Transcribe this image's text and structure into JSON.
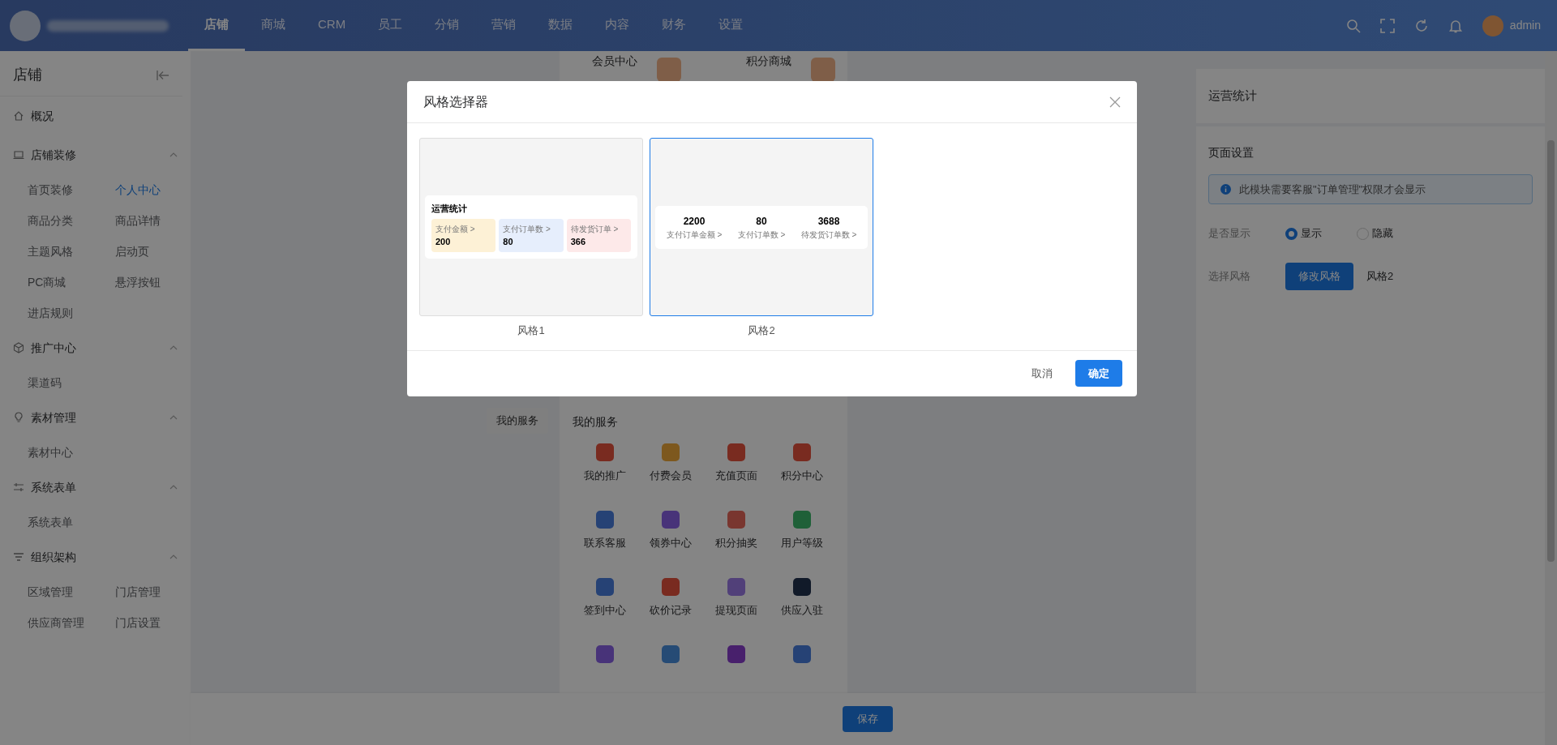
{
  "top_nav": {
    "tabs": [
      {
        "label": "店铺",
        "selected": true
      },
      {
        "label": "商城",
        "selected": false
      },
      {
        "label": "CRM",
        "selected": false
      },
      {
        "label": "员工",
        "selected": false
      },
      {
        "label": "分销",
        "selected": false
      },
      {
        "label": "营销",
        "selected": false
      },
      {
        "label": "数据",
        "selected": false
      },
      {
        "label": "内容",
        "selected": false
      },
      {
        "label": "财务",
        "selected": false
      },
      {
        "label": "设置",
        "selected": false
      }
    ],
    "user": "admin"
  },
  "sidebar": {
    "title": "店铺",
    "groups": [
      {
        "kind": "link",
        "label": "概况"
      },
      {
        "kind": "group",
        "label": "店铺装修",
        "expanded": true,
        "items": [
          {
            "label": "首页装修",
            "selected": false
          },
          {
            "label": "个人中心",
            "selected": true
          },
          {
            "label": "商品分类",
            "selected": false
          },
          {
            "label": "商品详情",
            "selected": false
          },
          {
            "label": "主题风格",
            "selected": false
          },
          {
            "label": "启动页",
            "selected": false
          },
          {
            "label": "PC商城",
            "selected": false
          },
          {
            "label": "悬浮按钮",
            "selected": false
          },
          {
            "label": "进店规则",
            "selected": false
          }
        ]
      },
      {
        "kind": "group",
        "label": "推广中心",
        "expanded": true,
        "items": [
          {
            "label": "渠道码",
            "selected": false
          }
        ]
      },
      {
        "kind": "group",
        "label": "素材管理",
        "expanded": true,
        "items": [
          {
            "label": "素材中心",
            "selected": false
          }
        ]
      },
      {
        "kind": "group",
        "label": "系统表单",
        "expanded": true,
        "items": [
          {
            "label": "系统表单",
            "selected": false
          }
        ]
      },
      {
        "kind": "group",
        "label": "组织架构",
        "expanded": true,
        "items": [
          {
            "label": "区域管理",
            "selected": false
          },
          {
            "label": "门店管理",
            "selected": false
          },
          {
            "label": "供应商管理",
            "selected": false
          },
          {
            "label": "门店设置",
            "selected": false
          }
        ]
      }
    ]
  },
  "preview": {
    "top_entries": [
      "会员中心",
      "积分商城"
    ],
    "tag": "我的服务",
    "section_title": "我的服务",
    "services": [
      "我的推广",
      "付费会员",
      "充值页面",
      "积分中心",
      "联系客服",
      "领券中心",
      "积分抽奖",
      "用户等级",
      "签到中心",
      "砍价记录",
      "提现页面",
      "供应入驻"
    ]
  },
  "right_panel": {
    "title": "运营统计",
    "section": "页面设置",
    "alert": "此模块需要客服\"订单管理\"权限才会显示",
    "show_label": "是否显示",
    "options": [
      {
        "label": "显示",
        "selected": true
      },
      {
        "label": "隐藏",
        "selected": false
      }
    ],
    "style_label": "选择风格",
    "style_button": "修改风格",
    "style_value": "风格2"
  },
  "save_button": "保存",
  "modal": {
    "title": "风格选择器",
    "styles": [
      {
        "kind": "cards",
        "label": "风格1",
        "selected": false,
        "title": "运营统计",
        "stats": [
          {
            "label": "支付金额 >",
            "value": "200",
            "color": "#fdf1d6"
          },
          {
            "label": "支付订单数 >",
            "value": "80",
            "color": "#e6eefc"
          },
          {
            "label": "待发货订单 >",
            "value": "366",
            "color": "#fde9e9"
          }
        ]
      },
      {
        "kind": "plain",
        "label": "风格2",
        "selected": true,
        "stats": [
          {
            "value": "2200",
            "label": "支付订单金额 >"
          },
          {
            "value": "80",
            "label": "支付订单数 >"
          },
          {
            "value": "3688",
            "label": "待发货订单数 >"
          }
        ]
      }
    ],
    "cancel": "取消",
    "confirm": "确定"
  }
}
